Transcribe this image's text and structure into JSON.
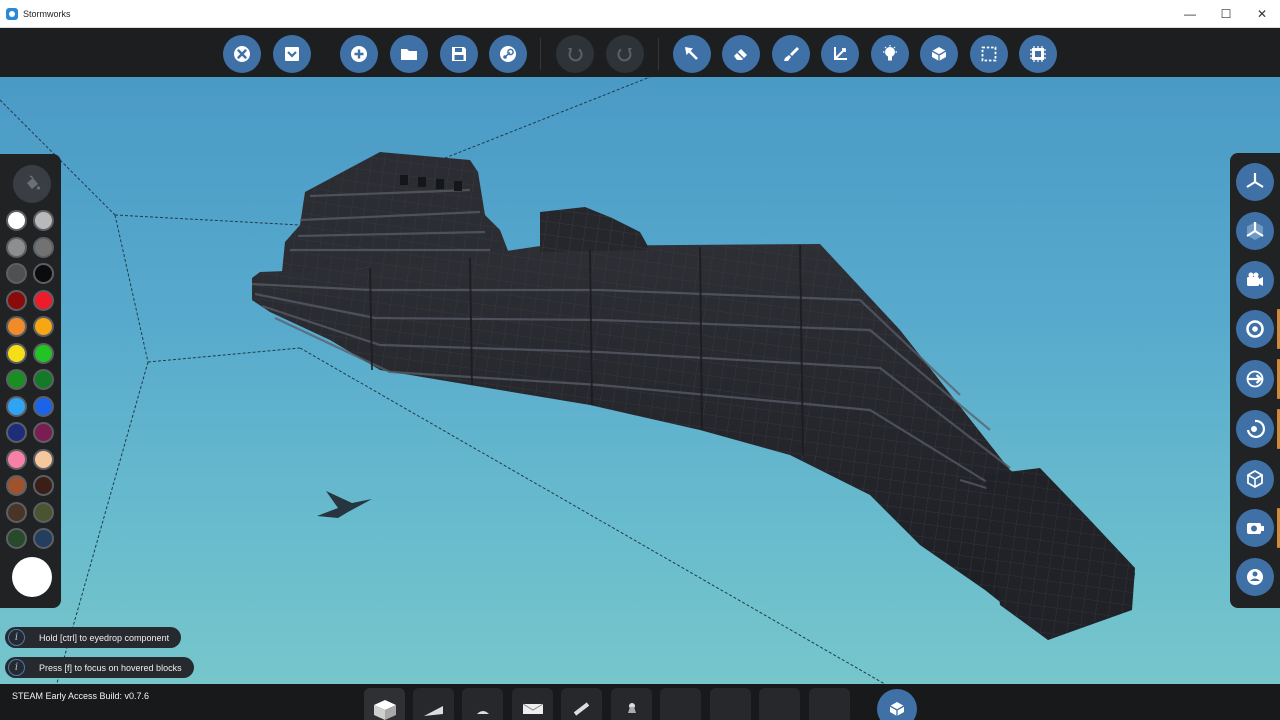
{
  "window": {
    "title": "Stormworks",
    "minimize": "—",
    "maximize": "☐",
    "close": "✕"
  },
  "toolbar": {
    "buttons": [
      {
        "name": "close-editor-button",
        "icon": "x-circle-icon"
      },
      {
        "name": "save-to-workbench-button",
        "icon": "download-icon"
      },
      {
        "name": "new-vehicle-button",
        "icon": "plus-icon"
      },
      {
        "name": "open-vehicle-button",
        "icon": "folder-icon"
      },
      {
        "name": "save-vehicle-button",
        "icon": "floppy-icon"
      },
      {
        "name": "steam-workshop-button",
        "icon": "steam-icon"
      },
      {
        "name": "undo-button",
        "icon": "undo-icon",
        "disabled": true
      },
      {
        "name": "redo-button",
        "icon": "redo-icon",
        "disabled": true
      },
      {
        "name": "select-tool-button",
        "icon": "cursor-icon"
      },
      {
        "name": "eraser-tool-button",
        "icon": "eraser-icon"
      },
      {
        "name": "paint-tool-button",
        "icon": "brush-icon"
      },
      {
        "name": "move-tool-button",
        "icon": "axes-icon"
      },
      {
        "name": "lighting-button",
        "icon": "lightbulb-icon"
      },
      {
        "name": "logic-view-button",
        "icon": "cube-network-icon"
      },
      {
        "name": "selection-box-button",
        "icon": "dashed-square-icon"
      },
      {
        "name": "microcontroller-button",
        "icon": "chip-icon"
      }
    ]
  },
  "palette": {
    "tool_icon": "paint-bucket-icon",
    "colors": [
      [
        "#ffffff",
        "#b9b9b9"
      ],
      [
        "#8e8e8e",
        "#727272"
      ],
      [
        "#505050",
        "#0c0c0c"
      ],
      [
        "#8b0a0a",
        "#ee1b2b"
      ],
      [
        "#f28a2a",
        "#f6a713"
      ],
      [
        "#f5de18",
        "#22c322"
      ],
      [
        "#1a8e22",
        "#147a28"
      ],
      [
        "#2fa4f4",
        "#1b63e8"
      ],
      [
        "#1d2d7a",
        "#7a1e52"
      ],
      [
        "#f680a6",
        "#f6c79c"
      ],
      [
        "#a0522d",
        "#3a1e17"
      ],
      [
        "#4a3426",
        "#4a5530"
      ],
      [
        "#274a2a",
        "#233e5e"
      ]
    ],
    "current_color": "#ffffff"
  },
  "right_panel": {
    "buttons": [
      {
        "name": "view-axes-button",
        "icon": "tri-axis-icon"
      },
      {
        "name": "view-axes-solid-button",
        "icon": "tri-axis-solid-icon"
      },
      {
        "name": "camera-button",
        "icon": "camera-icon"
      },
      {
        "name": "center-of-mass-button",
        "icon": "target-icon"
      },
      {
        "name": "thrust-vector-button",
        "icon": "arrow-circle-icon"
      },
      {
        "name": "rotation-button",
        "icon": "rotate-icon"
      },
      {
        "name": "block-view-button",
        "icon": "cube-icon"
      },
      {
        "name": "camera-settings-button",
        "icon": "camera-gear-icon"
      },
      {
        "name": "xray-button",
        "icon": "xray-icon"
      }
    ]
  },
  "hints": [
    "Hold [ctrl] to eyedrop component",
    "Press [f] to focus on hovered blocks"
  ],
  "hint_icon": "i",
  "build_info": "STEAM Early Access Build: v0.7.6",
  "bottom_bar": {
    "slots": [
      "block-icon",
      "wedge-icon",
      "slope-icon",
      "panel-icon",
      "pipe-icon",
      "connector-icon",
      "",
      "",
      "",
      ""
    ],
    "round_button_icon": "cube-network-icon"
  }
}
